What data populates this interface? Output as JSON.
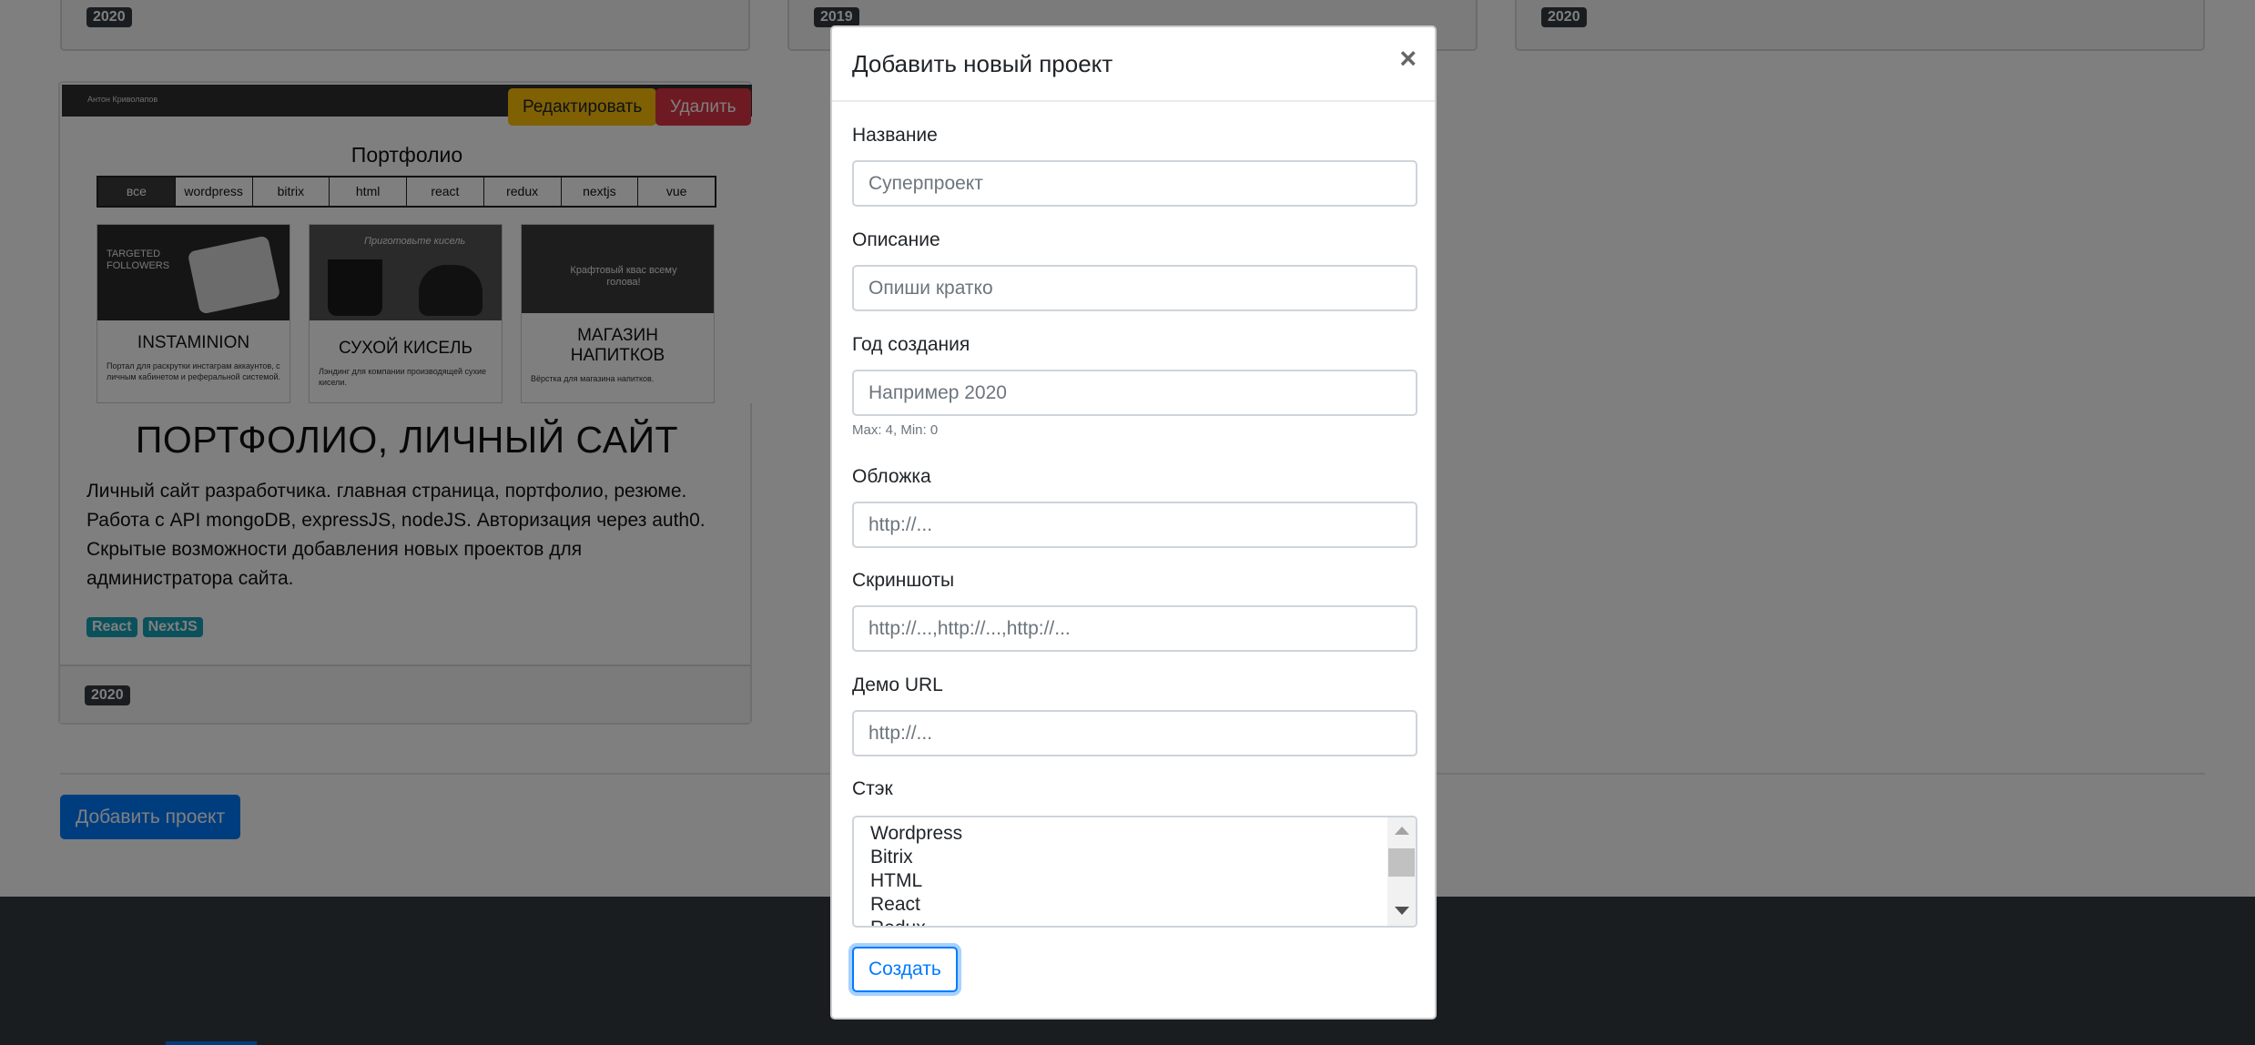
{
  "background": {
    "top_cards": [
      {
        "year": "2020"
      },
      {
        "year": "2019"
      },
      {
        "year": "2020"
      }
    ],
    "project_card": {
      "thumbnail": {
        "author_name": "Антон Криволапов",
        "portfolio_heading": "Портфолио",
        "filters": [
          "все",
          "wordpress",
          "bitrix",
          "html",
          "react",
          "redux",
          "nextjs",
          "vue"
        ],
        "mini_cards": [
          {
            "image_text": "TARGETED FOLLOWERS",
            "name": "INSTAMINION",
            "desc": "Портал для раскрутки инстаграм аккаунтов, с личным кабинетом и реферальной системой."
          },
          {
            "image_text": "Приготовьте кисель",
            "name": "СУХОЙ КИСЕЛЬ",
            "desc": "Лэндинг для компании производящей сухие кисели."
          },
          {
            "image_text": "Крафтовый квас всему голова!",
            "name": "МАГАЗИН НАПИТКОВ",
            "desc": "Вёрстка для магазина напитков."
          }
        ]
      },
      "edit_label": "Редактировать",
      "delete_label": "Удалить",
      "title": "ПОРТФОЛИО, ЛИЧНЫЙ САЙТ",
      "description": "Личный сайт разработчика. главная страница, портфолио, резюме. Работа с API mongoDB, expressJS, nodeJS. Авторизация через auth0. Скрытые возможности добавления новых проектов для администратора сайта.",
      "tags": [
        "React",
        "NextJS"
      ],
      "year": "2020"
    },
    "add_project_label": "Добавить проект"
  },
  "modal": {
    "title": "Добавить новый проект",
    "close_symbol": "×",
    "fields": {
      "name": {
        "label": "Название",
        "placeholder": "Суперпроект"
      },
      "description": {
        "label": "Описание",
        "placeholder": "Опиши кратко"
      },
      "year": {
        "label": "Год создания",
        "placeholder": "Например 2020",
        "help": "Max: 4, Min: 0"
      },
      "cover": {
        "label": "Обложка",
        "placeholder": "http://..."
      },
      "screenshots": {
        "label": "Скриншоты",
        "placeholder": "http://...,http://...,http://..."
      },
      "demo_url": {
        "label": "Демо URL",
        "placeholder": "http://..."
      },
      "stack": {
        "label": "Стэк",
        "options": [
          "Wordpress",
          "Bitrix",
          "HTML",
          "React",
          "Redux"
        ]
      }
    },
    "submit_label": "Создать"
  },
  "colors": {
    "primary": "#007bff",
    "warning": "#ffc107",
    "danger": "#dc3545",
    "info": "#17a2b8",
    "dark": "#343a40",
    "backdrop": "rgba(0,0,0,0.5)"
  }
}
